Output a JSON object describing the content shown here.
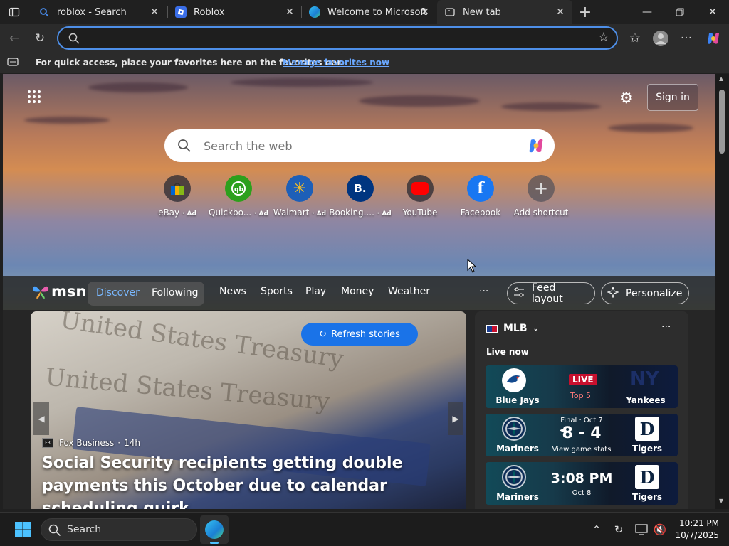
{
  "tabs": [
    {
      "title": "roblox - Search",
      "icon": "search-icon"
    },
    {
      "title": "Roblox",
      "icon": "roblox-icon"
    },
    {
      "title": "Welcome to Microsoft E",
      "icon": "edge-icon"
    },
    {
      "title": "New tab",
      "icon": "newtab-icon",
      "active": true
    }
  ],
  "toolbar": {
    "address_value": ""
  },
  "favorites_bar": {
    "message": "For quick access, place your favorites here on the favorites bar.",
    "link": "Manage favorites now"
  },
  "header": {
    "sign_in": "Sign in"
  },
  "search": {
    "placeholder": "Search the web"
  },
  "shortcuts": [
    {
      "label": "eBay",
      "ad": "· Ad",
      "icon": "ebay-icon"
    },
    {
      "label": "Quickbo...",
      "ad": "· Ad",
      "icon": "quickbooks-icon"
    },
    {
      "label": "Walmart",
      "ad": "· Ad",
      "icon": "walmart-icon"
    },
    {
      "label": "Booking....",
      "ad": "· Ad",
      "icon_text": "B.",
      "icon": "booking-icon"
    },
    {
      "label": "YouTube",
      "ad": "",
      "icon": "youtube-icon"
    },
    {
      "label": "Facebook",
      "ad": "",
      "icon_text": "f",
      "icon": "facebook-icon"
    },
    {
      "label": "Add shortcut",
      "ad": "",
      "icon_text": "+",
      "icon": "plus-icon"
    }
  ],
  "msn": {
    "logo_text": "msn",
    "tabs": [
      "Discover",
      "Following"
    ],
    "nav": [
      "News",
      "Sports",
      "Play",
      "Money",
      "Weather"
    ],
    "more": "···",
    "feed_layout": "Feed layout",
    "personalize": "Personalize"
  },
  "hero": {
    "refresh": "Refresh stories",
    "source": "Fox Business",
    "age": "14h",
    "headline": "Social Security recipients getting double payments this October due to calendar scheduling quirk"
  },
  "mlb": {
    "title": "MLB",
    "live_label": "Live now",
    "games": [
      {
        "home": "Blue Jays",
        "away": "Yankees",
        "status": "LIVE",
        "detail": "Top 5"
      },
      {
        "home": "Mariners",
        "away": "Tigers",
        "status": "Final · Oct 7",
        "score": "8 - 4",
        "detail": "View game stats"
      },
      {
        "home": "Mariners",
        "away": "Tigers",
        "time": "3:08 PM",
        "detail": "Oct 8"
      }
    ]
  },
  "taskbar": {
    "search_label": "Search",
    "time": "10:21 PM",
    "date": "10/7/2025"
  }
}
